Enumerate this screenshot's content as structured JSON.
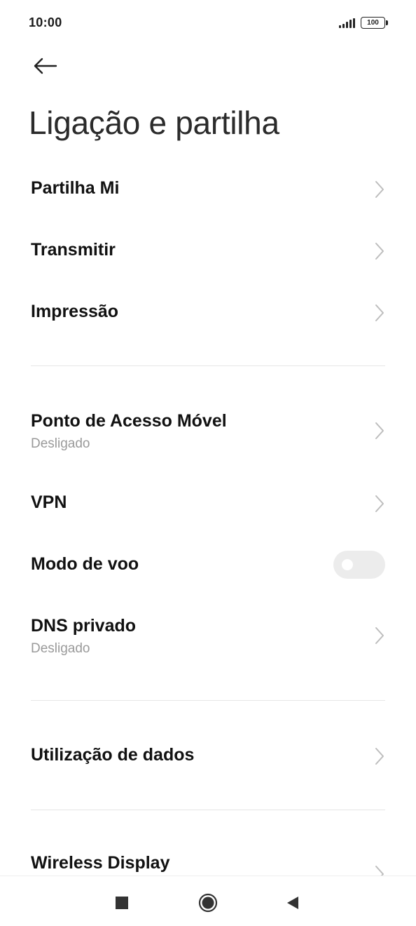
{
  "status_bar": {
    "time": "10:00",
    "battery": "100"
  },
  "header": {
    "back_icon": "arrow-left-icon",
    "title": "Ligação e partilha"
  },
  "items": [
    {
      "label": "Partilha Mi",
      "type": "chevron"
    },
    {
      "label": "Transmitir",
      "type": "chevron"
    },
    {
      "label": "Impressão",
      "type": "chevron"
    },
    {
      "label": "Ponto de Acesso Móvel",
      "sub": "Desligado",
      "type": "chevron"
    },
    {
      "label": "VPN",
      "type": "chevron"
    },
    {
      "label": "Modo de voo",
      "type": "toggle",
      "value": false
    },
    {
      "label": "DNS privado",
      "sub": "Desligado",
      "type": "chevron"
    },
    {
      "label": "Utilização de dados",
      "type": "chevron"
    },
    {
      "label": "Wireless Display",
      "type": "chevron"
    }
  ],
  "nav_bar": {
    "recents_icon": "square-icon",
    "home_icon": "circle-icon",
    "back_icon": "triangle-back-icon"
  },
  "colors": {
    "text": "#111111",
    "subtext": "#9a9a9a",
    "divider": "#e6e6e6",
    "toggle_off": "#ececec"
  }
}
